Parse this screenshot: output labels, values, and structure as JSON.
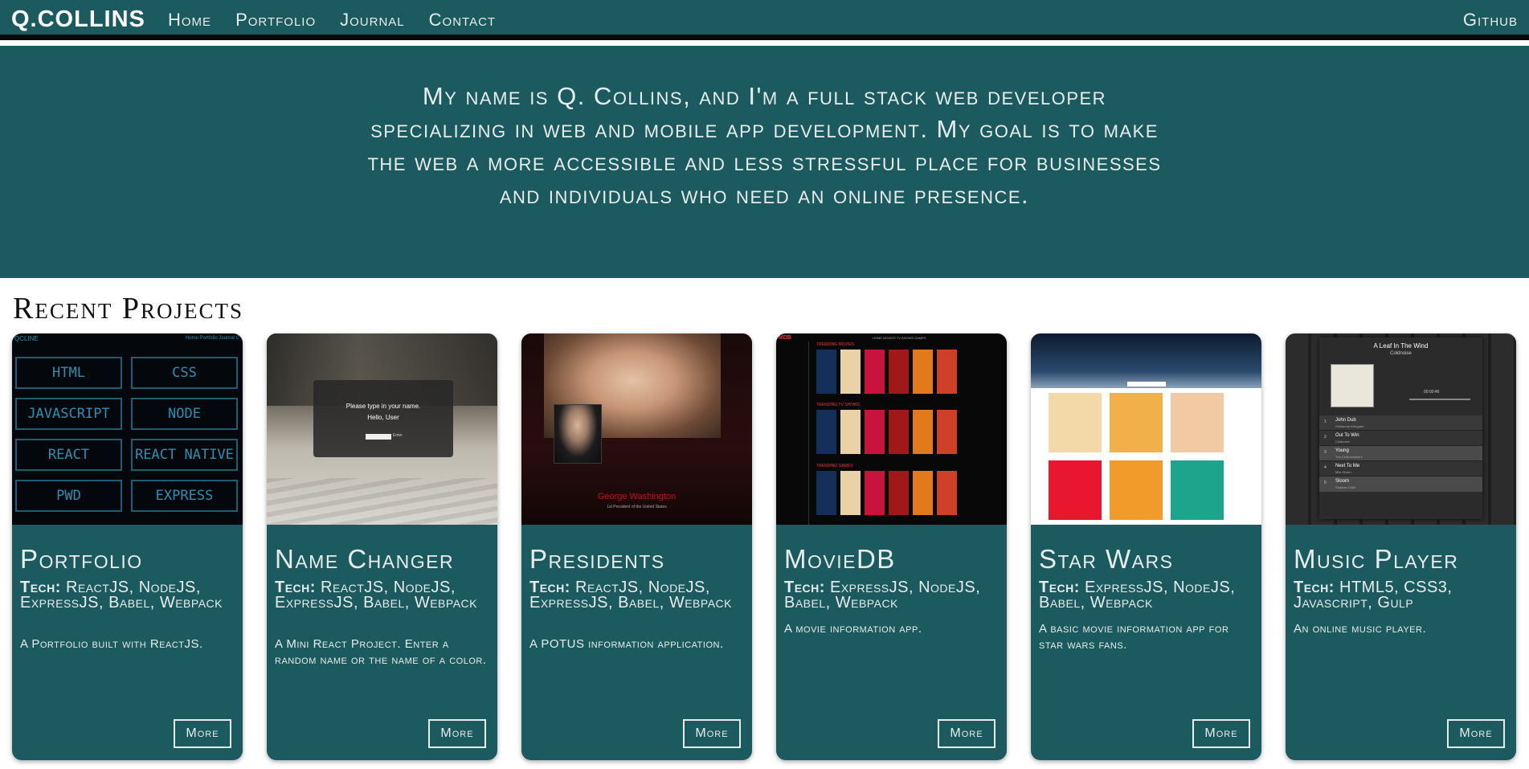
{
  "nav": {
    "brand": "Q.COLLINS",
    "links": [
      "Home",
      "Portfolio",
      "Journal",
      "Contact"
    ],
    "right_link": "Github"
  },
  "hero": {
    "text": "My name is Q. Collins, and I'm a full stack web developer specializing in web and mobile app development. My goal is to make the web a more accessible and less stressful place for businesses and individuals who need an online presence."
  },
  "projects_section": {
    "title": "Recent Projects"
  },
  "tech_label": "Tech:",
  "more_label": "More",
  "projects": [
    {
      "title": "Portfolio",
      "tech": "ReactJS, NodeJS, ExpressJS, Babel, Webpack",
      "description": "A Portfolio built with ReactJS.",
      "thumb": {
        "header_logo": "QCLINE",
        "header_links": "Home  Portfolio  Journal  C",
        "skills": [
          "HTML",
          "CSS",
          "JAVASCRIPT",
          "NODE",
          "REACT",
          "REACT NATIVE",
          "PWD",
          "EXPRESS"
        ]
      }
    },
    {
      "title": "Name Changer",
      "tech": "ReactJS, NodeJS, ExpressJS, Babel, Webpack",
      "description": "A Mini React Project. Enter a random name or the name of a color.",
      "thumb": {
        "prompt": "Please type in your name.",
        "greeting": "Hello, User",
        "button": "Enter"
      }
    },
    {
      "title": "Presidents",
      "tech": "ReactJS, NodeJS, ExpressJS, Babel, Webpack",
      "description": "A POTUS information application.",
      "thumb": {
        "name": "George Washington",
        "subtitle": "1st President of the United States"
      }
    },
    {
      "title": "MovieDB",
      "tech": "ExpressJS, NodeJS, Babel, Webpack",
      "description": "A movie information app.",
      "thumb": {
        "logo": "MDB",
        "rows": [
          "TRENDING MOVIES",
          "TRENDING TV SHOWS",
          "TRENDING GAMES"
        ],
        "top_links": "HOME  MOVIES  TV SHOWS  GAMES"
      }
    },
    {
      "title": "Star Wars",
      "tech": "ExpressJS, NodeJS, Babel, Webpack",
      "description": "A basic movie information app for star wars fans.",
      "thumb": {}
    },
    {
      "title": "Music Player",
      "tech": "HTML5, CSS3, Javascript, Gulp",
      "description": "An online music player.",
      "thumb": {
        "song": "A Leaf In The Wind",
        "artist": "Coldnoise",
        "time": "00:00:46",
        "tracks": [
          {
            "n": "1",
            "title": "John Dub",
            "artist": "Guillaume Arbogast"
          },
          {
            "n": "2",
            "title": "Out To Win",
            "artist": "Coldnoise"
          },
          {
            "n": "3",
            "title": "Young",
            "artist": "The Chainsmokers"
          },
          {
            "n": "4",
            "title": "Next To Me",
            "artist": "Milo Green"
          },
          {
            "n": "5",
            "title": "Sloom",
            "artist": "Shadow Child"
          }
        ]
      }
    }
  ],
  "colors": {
    "teal": "#1b5a5e",
    "text_light": "#e8ecec",
    "nav_border": "#0a0a0a"
  }
}
